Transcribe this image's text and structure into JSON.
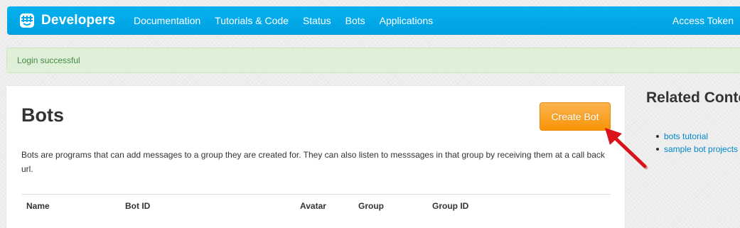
{
  "navbar": {
    "brand": "Developers",
    "links": [
      "Documentation",
      "Tutorials & Code",
      "Status",
      "Bots",
      "Applications"
    ],
    "right_link": "Access Token",
    "color": "#00a9ec"
  },
  "alert": {
    "message": "Login successful",
    "color": "#dff0d8"
  },
  "main": {
    "title": "Bots",
    "create_button_label": "Create Bot",
    "create_button_color": "#f89406",
    "description": "Bots are programs that can add messages to a group they are created for. They can also listen to messsages in that group by receiving them at a call back url.",
    "table_headers": [
      "Name",
      "Bot ID",
      "Avatar",
      "Group",
      "Group ID"
    ]
  },
  "annotation": {
    "arrow_color": "#d9121b"
  },
  "sidebar": {
    "title": "Related Content",
    "links": [
      "bots tutorial",
      "sample bot projects"
    ]
  }
}
